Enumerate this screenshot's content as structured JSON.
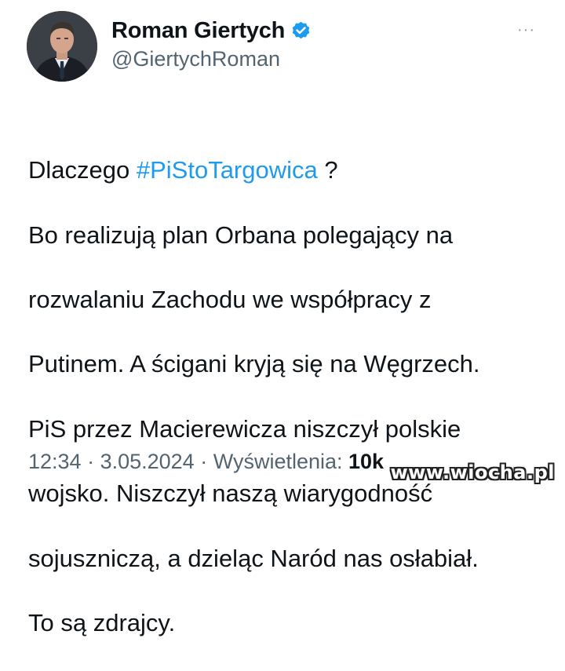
{
  "author": {
    "display_name": "Roman Giertych",
    "handle": "@GiertychRoman",
    "verified": true,
    "verified_color": "#1d9bf0"
  },
  "more_icon": "more-options-icon",
  "tweet": {
    "line1_prefix": "Dlaczego ",
    "hashtag": "#PiStoTargowica",
    "line1_suffix": " ?",
    "lines": [
      "Bo realizują plan Orbana polegający na",
      "rozwalaniu Zachodu we współpracy z",
      "Putinem. A ścigani kryją się na Węgrzech.",
      "PiS przez Macierewicza niszczył  polskie",
      "wojsko. Niszczył naszą wiarygodność",
      "sojuszniczą, a dzieląc Naród nas osłabiał.",
      "To są zdrajcy."
    ],
    "hashtag_color": "#1d9bf0"
  },
  "meta": {
    "time": "12:34",
    "separator": " · ",
    "date": "3.05.2024",
    "views_label": "Wyświetlenia: ",
    "views_count": "10k"
  },
  "watermark": "www.wiocha.pl"
}
